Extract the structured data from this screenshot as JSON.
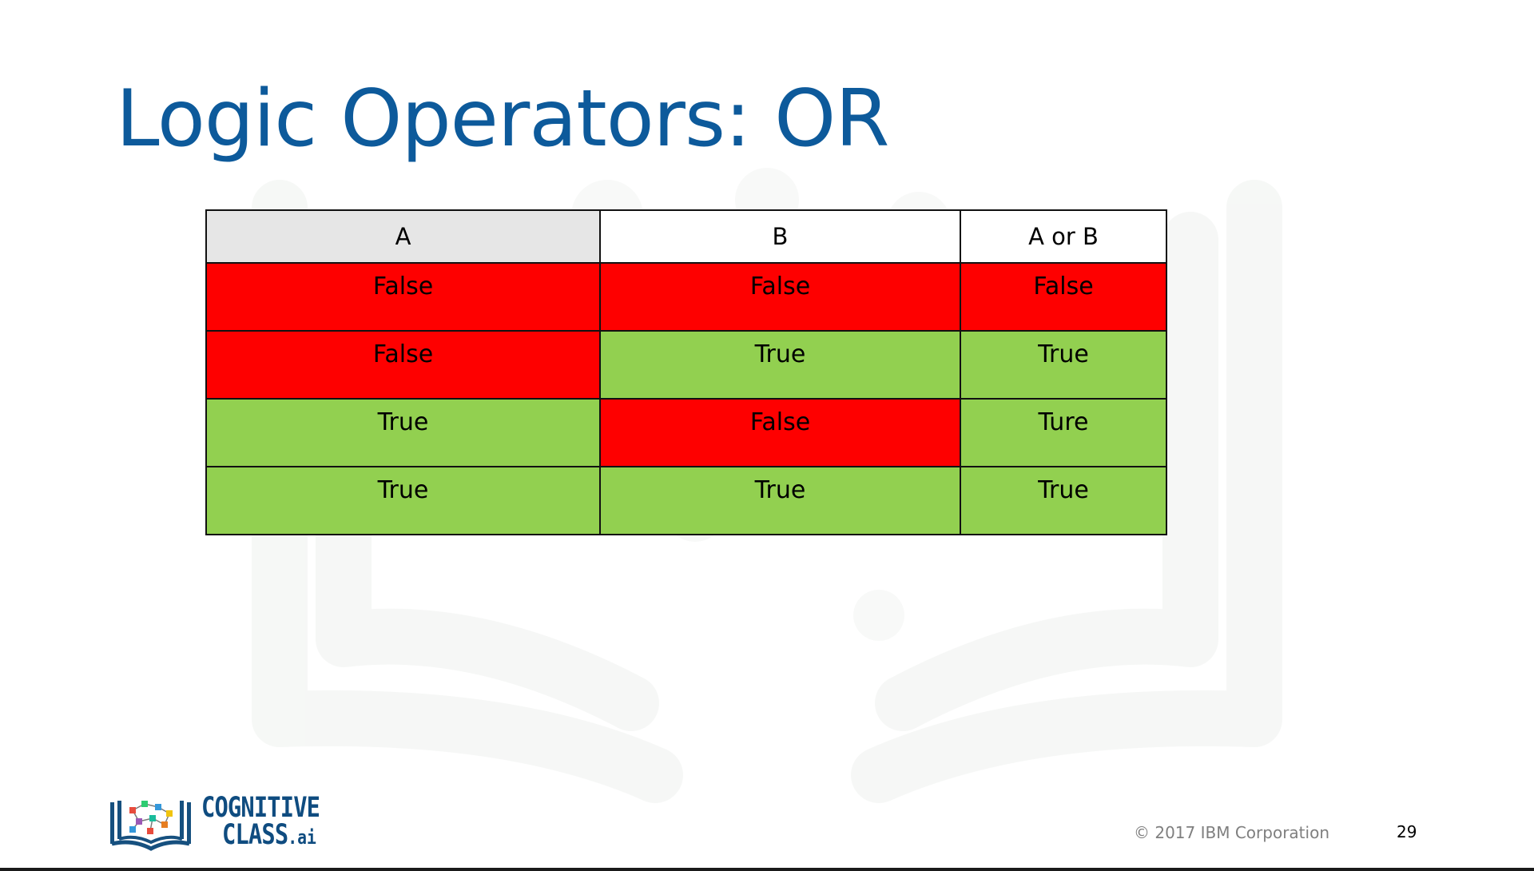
{
  "slide": {
    "title": "Logic Operators: OR",
    "footer": {
      "copyright": "© 2017 IBM Corporation",
      "page_number": "29"
    },
    "logo": {
      "line1": "COGNITIVE",
      "line2": "CLASS",
      "line2_suffix": ".ai"
    }
  },
  "truth_table": {
    "headers": [
      "A",
      "B",
      "A or  B"
    ],
    "rows": [
      [
        "False",
        "False",
        "False"
      ],
      [
        "False",
        "True",
        "True"
      ],
      [
        "True",
        "False",
        "Ture"
      ],
      [
        "True",
        "True",
        "True"
      ]
    ]
  },
  "colors": {
    "title": "#0d5a9b",
    "false_cell": "#fe0000",
    "true_cell": "#92d050",
    "header_a": "#e6e6e6",
    "logo_text": "#0f4c80"
  }
}
